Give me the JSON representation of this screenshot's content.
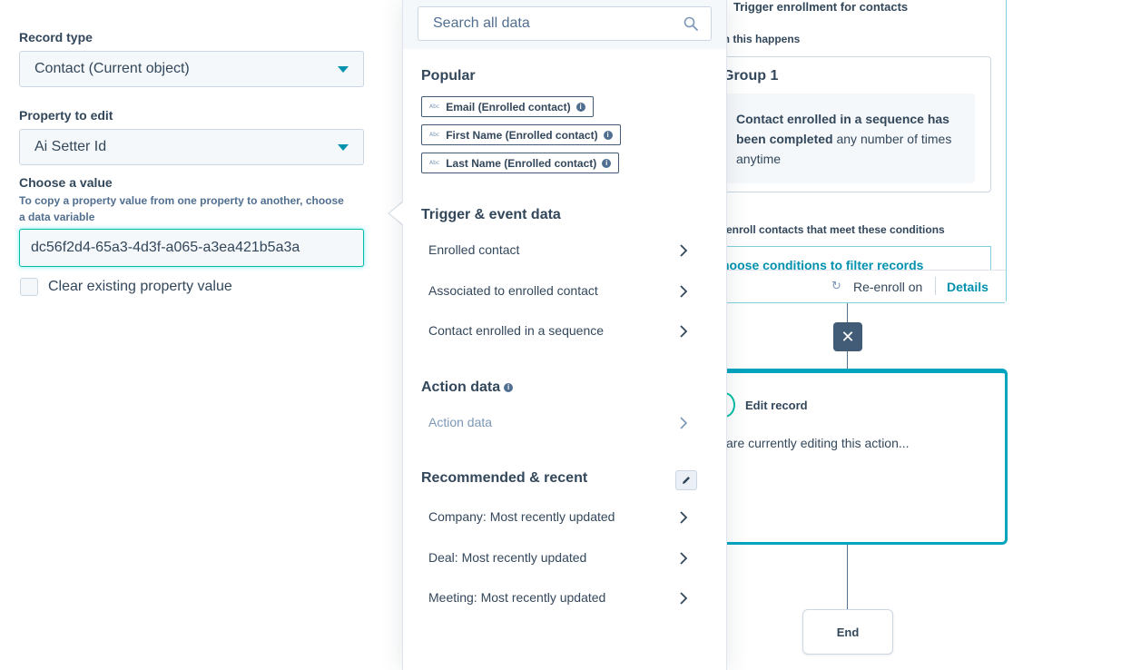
{
  "form": {
    "record_type_label": "Record type",
    "record_type_value": "Contact (Current object)",
    "property_label": "Property to edit",
    "property_value": "Ai Setter Id",
    "choose_value_label": "Choose a value",
    "choose_value_help": "To copy a property value from one property to another, choose a data variable",
    "value_input": "dc56f2d4-65a3-4d3f-a065-a3ea421b5a3a",
    "clear_label": "Clear existing property value"
  },
  "picker": {
    "search_placeholder": "Search all data",
    "popular_title": "Popular",
    "popular_chips": [
      {
        "abc": "Abc",
        "label": "Email (Enrolled contact)"
      },
      {
        "abc": "Abc",
        "label": "First Name (Enrolled contact)"
      },
      {
        "abc": "Abc",
        "label": "Last Name (Enrolled contact)"
      }
    ],
    "trigger_title": "Trigger & event data",
    "trigger_items": [
      "Enrolled contact",
      "Associated to enrolled contact",
      "Contact enrolled in a sequence"
    ],
    "action_title": "Action data",
    "action_items": [
      "Action data"
    ],
    "recent_title": "Recommended & recent",
    "recent_items": [
      "Company: Most recently updated",
      "Deal: Most recently updated",
      "Meeting: Most recently updated"
    ],
    "info_glyph": "i"
  },
  "workflow": {
    "trigger_title": "Trigger enrollment for contacts",
    "when_label": "en this happens",
    "group_title": "Group 1",
    "filter_bold": "Contact enrolled in a sequence has been completed",
    "filter_rest": " any number of times anytime",
    "only_enroll": "y enroll contacts that meet these conditions",
    "choose_conditions": "hoose conditions to filter records",
    "reenroll_glyph": "↻",
    "reenroll": "Re-enroll on",
    "details": "Details",
    "delete_glyph": "✕",
    "action_title": "Edit record",
    "action_desc": "are currently editing this action...",
    "end": "End"
  },
  "colors": {
    "accent": "#00a4bd",
    "teal": "#00bda5",
    "link": "#0091ae",
    "text": "#33475b"
  }
}
